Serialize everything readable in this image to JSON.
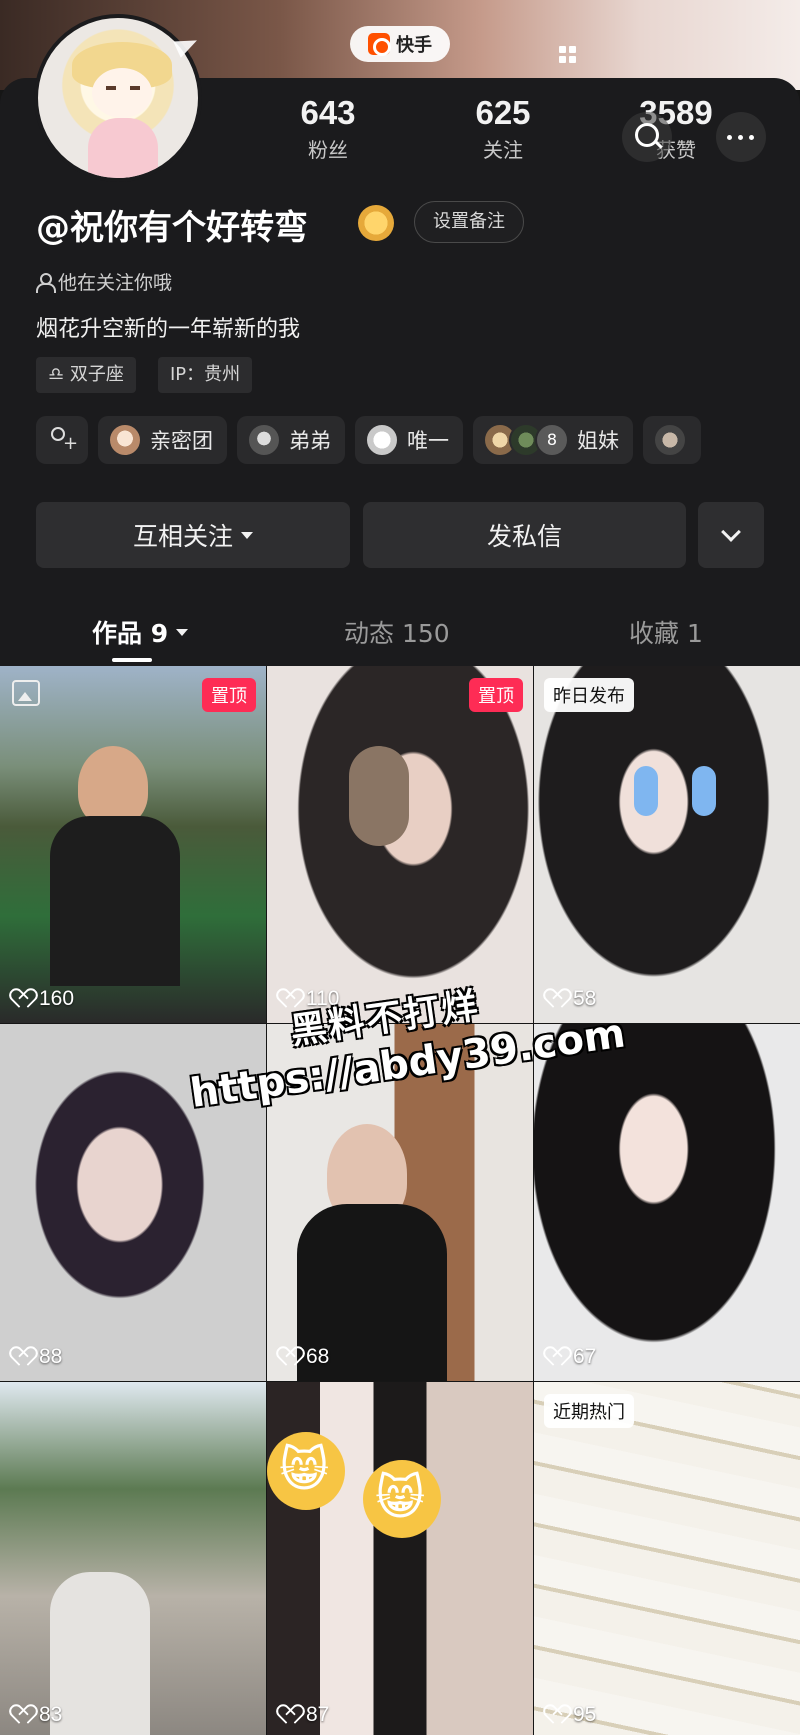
{
  "app": {
    "name": "快手"
  },
  "profile": {
    "username": "@祝你有个好转弯",
    "remark_button": "设置备注",
    "follows_you": "他在关注你哦",
    "bio": "烟花升空新的一年崭新的我",
    "tags": [
      "♎ 双子座",
      "IP：贵州"
    ]
  },
  "stats": [
    {
      "value": "643",
      "label": "粉丝"
    },
    {
      "value": "625",
      "label": "关注"
    },
    {
      "value": "3589",
      "label": "获赞"
    }
  ],
  "friends": [
    {
      "label": "亲密团",
      "icon": "avatar-1"
    },
    {
      "label": "弟弟",
      "icon": "avatar-2"
    },
    {
      "label": "唯一",
      "icon": "avatar-3"
    },
    {
      "label": "姐妹",
      "stack_count": "8"
    }
  ],
  "actions": {
    "mutual": "互相关注",
    "message": "发私信"
  },
  "tabs": [
    {
      "label": "作品 9",
      "active": true
    },
    {
      "label": "动态 150",
      "active": false
    },
    {
      "label": "收藏 1",
      "active": false
    }
  ],
  "videos": [
    {
      "likes": "160",
      "badge": "置顶",
      "badge_type": "pinned"
    },
    {
      "likes": "110",
      "badge": "置顶",
      "badge_type": "pinned"
    },
    {
      "likes": "58",
      "badge": "昨日发布",
      "badge_type": "light"
    },
    {
      "likes": "88",
      "badge": "",
      "badge_type": ""
    },
    {
      "likes": "68",
      "badge": "",
      "badge_type": ""
    },
    {
      "likes": "67",
      "badge": "",
      "badge_type": ""
    },
    {
      "likes": "83",
      "badge": "",
      "badge_type": ""
    },
    {
      "likes": "87",
      "badge": "",
      "badge_type": ""
    },
    {
      "likes": "95",
      "badge": "近期热门",
      "badge_type": "light"
    }
  ],
  "watermark": {
    "line1": "黑料不打烊",
    "line2": "https://abdy39.com"
  },
  "colors": {
    "pin_badge": "#fe2c55",
    "background": "#1b1b1d",
    "button": "#2e2e30"
  }
}
